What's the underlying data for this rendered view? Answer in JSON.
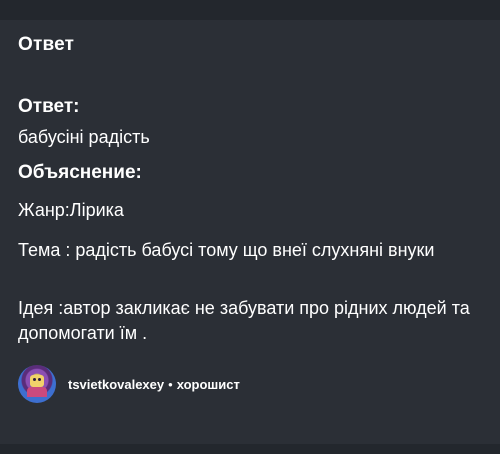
{
  "header": {
    "title": "Ответ"
  },
  "answer": {
    "label": "Ответ:",
    "text": "бабусіні радість"
  },
  "explanation": {
    "label": "Объяснение:",
    "paragraphs": [
      "Жанр:Лірика",
      "Тема : радість бабусі тому що внеї слухняні внуки",
      "Ідея :автор закликає не забувати про рідних людей та допомогати їм ."
    ]
  },
  "author": {
    "username": "tsvietkovalexey",
    "separator": "•",
    "rank": "хорошист"
  },
  "colors": {
    "background": "#2b2f36",
    "text": "#ffffff"
  }
}
